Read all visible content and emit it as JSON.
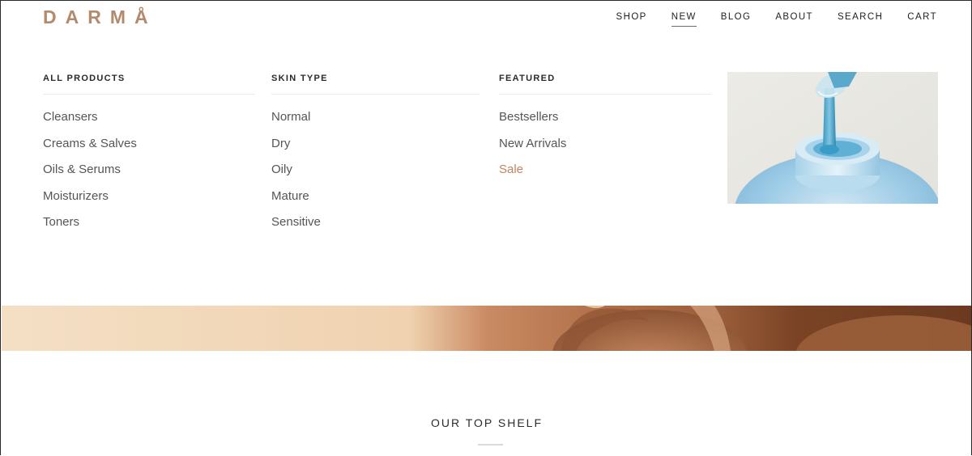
{
  "header": {
    "logo": "DARMÅ",
    "nav": [
      {
        "label": "SHOP"
      },
      {
        "label": "NEW"
      },
      {
        "label": "BLOG"
      },
      {
        "label": "ABOUT"
      },
      {
        "label": "SEARCH"
      },
      {
        "label": "CART"
      }
    ]
  },
  "menu": {
    "all_products": {
      "title": "ALL PRODUCTS",
      "items": [
        "Cleansers",
        "Creams & Salves",
        "Oils & Serums",
        "Moisturizers",
        "Toners"
      ]
    },
    "skin_type": {
      "title": "SKIN TYPE",
      "items": [
        "Normal",
        "Dry",
        "Oily",
        "Mature",
        "Sensitive"
      ]
    },
    "featured": {
      "title": "FEATURED",
      "items": [
        "Bestsellers",
        "New Arrivals",
        "Sale"
      ]
    }
  },
  "section": {
    "title": "OUR TOP SHELF"
  },
  "colors": {
    "brand": "#b48a6c",
    "sale": "#c0855f"
  }
}
